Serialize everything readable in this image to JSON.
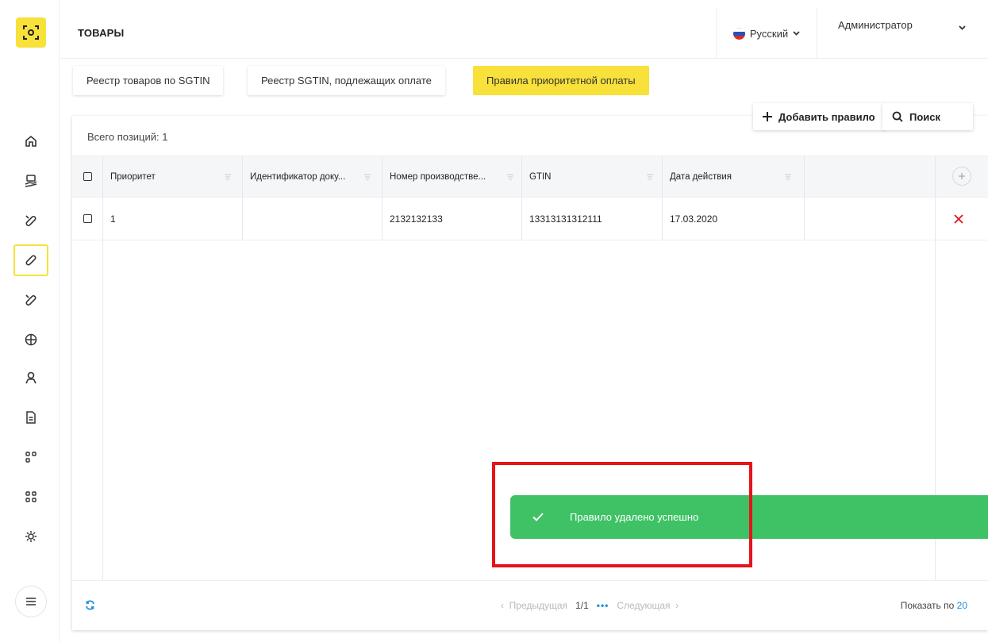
{
  "header": {
    "title": "ТОВАРЫ",
    "language": "Русский",
    "user": "Администратор"
  },
  "tabs": [
    {
      "label": "Реестр товаров по SGTIN",
      "active": false
    },
    {
      "label": "Реестр SGTIN, подлежащих оплате",
      "active": false
    },
    {
      "label": "Правила приоритетной оплаты",
      "active": true
    }
  ],
  "actions": {
    "add_rule": "Добавить правило",
    "search": "Поиск"
  },
  "table": {
    "total": "Всего позиций: 1",
    "columns": [
      "Приоритет",
      "Идентификатор доку...",
      "Номер производстве...",
      "GTIN",
      "Дата действия"
    ],
    "rows": [
      {
        "priority": "1",
        "doc_id": "",
        "serial": "2132132133",
        "gtin": "13313131312111",
        "date": "17.03.2020"
      }
    ]
  },
  "footer": {
    "prev": "Предыдущая",
    "page": "1/1",
    "dots": "•••",
    "next": "Следующая",
    "show_label": "Показать по",
    "show_count": "20"
  },
  "toast": {
    "message": "Правило удалено успешно"
  },
  "colors": {
    "accent": "#f7e13a",
    "success": "#3ec265",
    "danger": "#e5131a",
    "link": "#1a8fd8"
  }
}
